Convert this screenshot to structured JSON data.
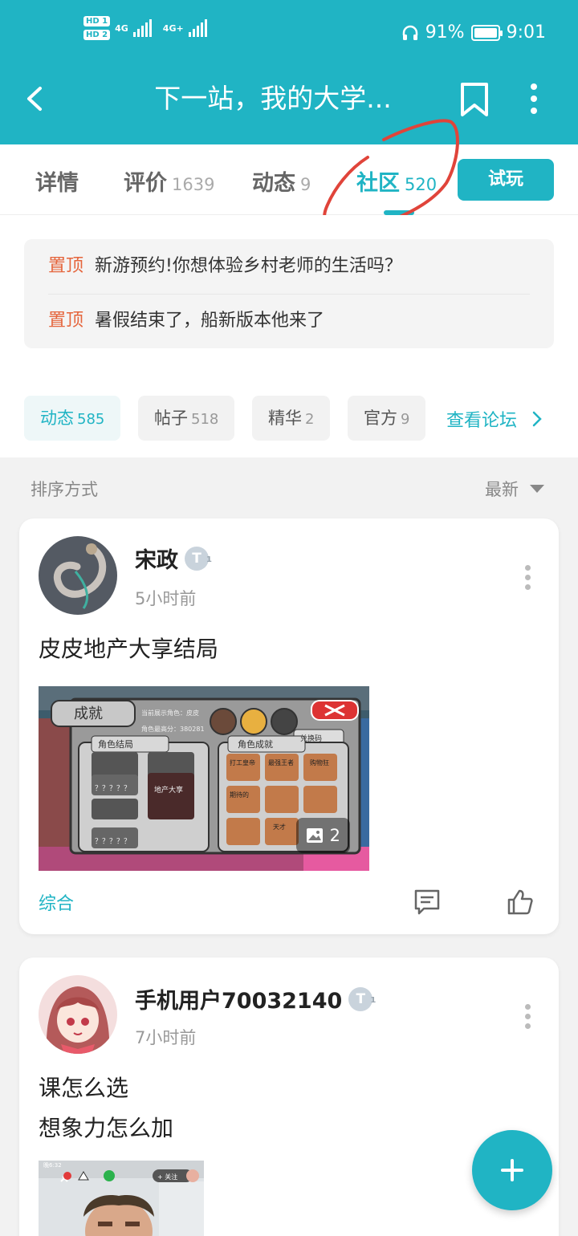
{
  "status_bar": {
    "hd1": "HD 1",
    "hd2": "HD 2",
    "net1": "4G",
    "net2": "4G+",
    "battery": "91%",
    "time": "9:01"
  },
  "header": {
    "title": "下一站，我的大学...",
    "icons": [
      "back-icon",
      "bookmark-icon",
      "more-vertical-icon"
    ]
  },
  "tabs": [
    {
      "label": "详情",
      "count": ""
    },
    {
      "label": "评价",
      "count": "1639"
    },
    {
      "label": "动态",
      "count": "9"
    },
    {
      "label": "社区",
      "count": "520"
    }
  ],
  "try_button": "试玩",
  "pinned": [
    {
      "tag": "置顶",
      "text": "新游预约!你想体验乡村老师的生活吗？"
    },
    {
      "tag": "置顶",
      "text": "暑假结束了，船新版本他来了"
    }
  ],
  "filters": [
    {
      "label": "动态",
      "count": "585"
    },
    {
      "label": "帖子",
      "count": "518"
    },
    {
      "label": "精华",
      "count": "2"
    },
    {
      "label": "官方",
      "count": "9"
    }
  ],
  "forum_link": "查看论坛",
  "sort": {
    "label": "排序方式",
    "value": "最新"
  },
  "posts": [
    {
      "user": "宋政",
      "level_badge": "T",
      "time": "5小时前",
      "lines": [
        "皮皮地产大享结局"
      ],
      "image_count": "2",
      "tag": "综合",
      "screenshot": {
        "title": "成就",
        "info1": "当前展示角色：皮皮",
        "info2": "角色最高分：380281",
        "left_header": "角色结局",
        "right_header": "角色成就",
        "redeem": "兑换码",
        "ending": "地产大享",
        "achievements": [
          "打工皇帝",
          "最强王者",
          "购物狂",
          "期待的",
          "",
          "",
          "",
          "天才",
          ""
        ],
        "unknown": "？？？？？"
      }
    },
    {
      "user": "手机用户70032140",
      "level_badge": "T",
      "time": "7小时前",
      "lines": [
        "课怎么选",
        "想象力怎么加"
      ],
      "image_overlay": {
        "time": "晚6:32",
        "follow": "+ 关注"
      }
    }
  ],
  "colors": {
    "accent": "#20b4c4",
    "pin": "#e5653c",
    "annotation": "#e0443a"
  }
}
